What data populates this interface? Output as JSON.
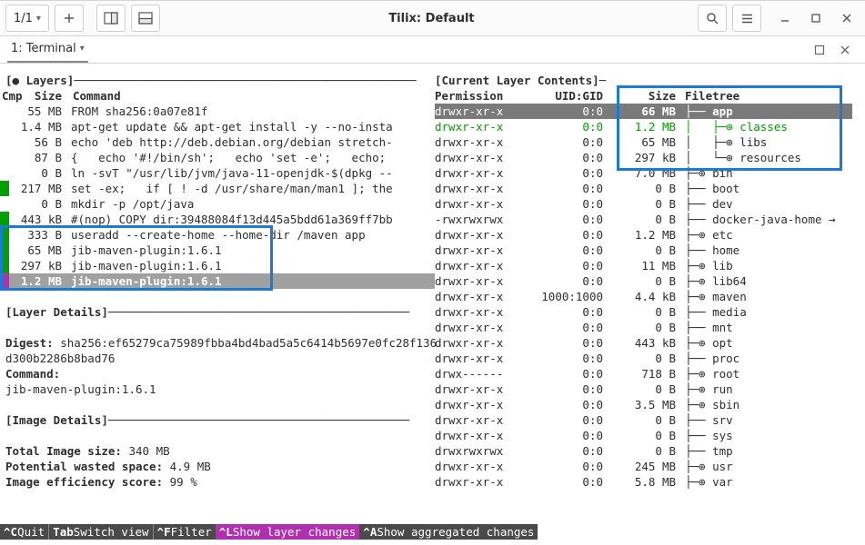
{
  "window": {
    "title": "Tilix: Default",
    "pageIndicator": "1/1"
  },
  "tabbar": {
    "tabLabel": "1: Terminal"
  },
  "layers": {
    "title_open": "[",
    "title_text": "● Layers",
    "title_close": "]",
    "header": {
      "cmp": "Cmp",
      "size": "Size",
      "command": "Command"
    },
    "rows": [
      {
        "cmp": "",
        "size": "55 MB",
        "command": "FROM sha256:0a07e81f"
      },
      {
        "cmp": "",
        "size": "1.4 MB",
        "command": "apt-get update && apt-get install -y --no-insta"
      },
      {
        "cmp": "",
        "size": "56 B",
        "command": "echo 'deb http://deb.debian.org/debian stretch-"
      },
      {
        "cmp": "",
        "size": "87 B",
        "command": "{   echo '#!/bin/sh';   echo 'set -e';   echo;"
      },
      {
        "cmp": "",
        "size": "0 B",
        "command": "ln -svT \"/usr/lib/jvm/java-11-openjdk-$(dpkg --"
      },
      {
        "cmp": "g",
        "size": "217 MB",
        "command": "set -ex;   if [ ! -d /usr/share/man/man1 ]; the"
      },
      {
        "cmp": "",
        "size": "0 B",
        "command": "mkdir -p /opt/java"
      },
      {
        "cmp": "g",
        "size": "443 kB",
        "command": "#(nop) COPY dir:39488084f13d445a5bdd61a369ff7bb"
      },
      {
        "cmp": "g",
        "size": "333 B",
        "command": "useradd --create-home --home-dir /maven app"
      },
      {
        "cmp": "g",
        "size": "65 MB",
        "command": "jib-maven-plugin:1.6.1"
      },
      {
        "cmp": "g",
        "size": "297 kB",
        "command": "jib-maven-plugin:1.6.1"
      },
      {
        "cmp": "m",
        "size": "1.2 MB",
        "command": "jib-maven-plugin:1.6.1",
        "selected": true
      }
    ]
  },
  "layerDetails": {
    "title": "[Layer Details]",
    "digest_label": "Digest:",
    "digest_value": "sha256:ef65279ca75989fbba4bd4bad5a5c6414b5697e0fc28f136d300b2286b8bad76",
    "command_label": "Command:",
    "command_value": "jib-maven-plugin:1.6.1"
  },
  "imageDetails": {
    "title": "[Image Details]",
    "total_label": "Total Image size:",
    "total_value": "340 MB",
    "wasted_label": "Potential wasted space:",
    "wasted_value": "4.9 MB",
    "eff_label": "Image efficiency score:",
    "eff_value": "99 %"
  },
  "filetree": {
    "title": "[Current Layer Contents]",
    "header": {
      "perm": "Permission",
      "ugid": "UID:GID",
      "size": "Size",
      "tree": "Filetree"
    },
    "rows": [
      {
        "perm": "drwxr-xr-x",
        "ugid": "0:0",
        "size": "66 MB",
        "tree": "├── app",
        "hl": true
      },
      {
        "perm": "drwxr-xr-x",
        "ugid": "0:0",
        "size": "1.2 MB",
        "tree": "│   ├─⊕ classes",
        "green": true
      },
      {
        "perm": "drwxr-xr-x",
        "ugid": "0:0",
        "size": "65 MB",
        "tree": "│   ├─⊕ libs"
      },
      {
        "perm": "drwxr-xr-x",
        "ugid": "0:0",
        "size": "297 kB",
        "tree": "│   └─⊕ resources"
      },
      {
        "perm": "drwxr-xr-x",
        "ugid": "0:0",
        "size": "7.0 MB",
        "tree": "├─⊕ bin"
      },
      {
        "perm": "drwxr-xr-x",
        "ugid": "0:0",
        "size": "0 B",
        "tree": "├── boot"
      },
      {
        "perm": "drwxr-xr-x",
        "ugid": "0:0",
        "size": "0 B",
        "tree": "├── dev"
      },
      {
        "perm": "-rwxrwxrwx",
        "ugid": "0:0",
        "size": "0 B",
        "tree": "├── docker-java-home →"
      },
      {
        "perm": "drwxr-xr-x",
        "ugid": "0:0",
        "size": "1.2 MB",
        "tree": "├─⊕ etc"
      },
      {
        "perm": "drwxr-xr-x",
        "ugid": "0:0",
        "size": "0 B",
        "tree": "├── home"
      },
      {
        "perm": "drwxr-xr-x",
        "ugid": "0:0",
        "size": "11 MB",
        "tree": "├─⊕ lib"
      },
      {
        "perm": "drwxr-xr-x",
        "ugid": "0:0",
        "size": "0 B",
        "tree": "├─⊕ lib64"
      },
      {
        "perm": "drwxr-xr-x",
        "ugid": "1000:1000",
        "size": "4.4 kB",
        "tree": "├─⊕ maven"
      },
      {
        "perm": "drwxr-xr-x",
        "ugid": "0:0",
        "size": "0 B",
        "tree": "├── media"
      },
      {
        "perm": "drwxr-xr-x",
        "ugid": "0:0",
        "size": "0 B",
        "tree": "├── mnt"
      },
      {
        "perm": "drwxr-xr-x",
        "ugid": "0:0",
        "size": "443 kB",
        "tree": "├─⊕ opt"
      },
      {
        "perm": "drwxr-xr-x",
        "ugid": "0:0",
        "size": "0 B",
        "tree": "├── proc"
      },
      {
        "perm": "drwx------",
        "ugid": "0:0",
        "size": "718 B",
        "tree": "├─⊕ root"
      },
      {
        "perm": "drwxr-xr-x",
        "ugid": "0:0",
        "size": "0 B",
        "tree": "├─⊕ run"
      },
      {
        "perm": "drwxr-xr-x",
        "ugid": "0:0",
        "size": "3.5 MB",
        "tree": "├─⊕ sbin"
      },
      {
        "perm": "drwxr-xr-x",
        "ugid": "0:0",
        "size": "0 B",
        "tree": "├── srv"
      },
      {
        "perm": "drwxr-xr-x",
        "ugid": "0:0",
        "size": "0 B",
        "tree": "├── sys"
      },
      {
        "perm": "drwxrwxrwx",
        "ugid": "0:0",
        "size": "0 B",
        "tree": "├── tmp"
      },
      {
        "perm": "drwxr-xr-x",
        "ugid": "0:0",
        "size": "245 MB",
        "tree": "├─⊕ usr"
      },
      {
        "perm": "drwxr-xr-x",
        "ugid": "0:0",
        "size": "5.8 MB",
        "tree": "├─⊕ var"
      }
    ]
  },
  "keybar": {
    "quit_key": "^C",
    "quit_lab": "Quit",
    "tab_key": "Tab",
    "tab_lab": "Switch view",
    "filter_key": "^F",
    "filter_lab": "Filter",
    "layer_key": "^L",
    "layer_lab": "Show layer changes",
    "agg_key": "^A",
    "agg_lab": "Show aggregated changes"
  }
}
